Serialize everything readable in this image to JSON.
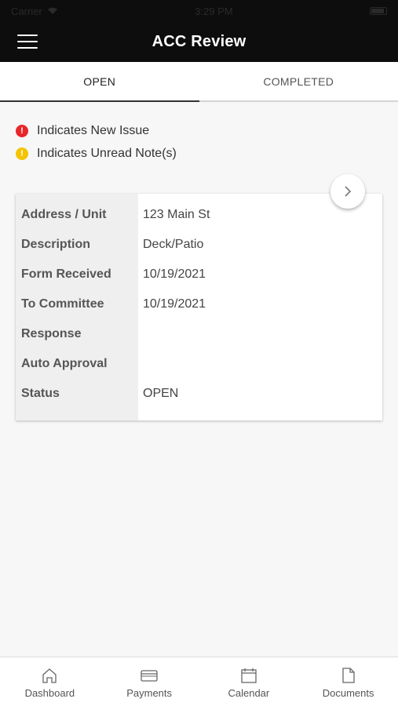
{
  "status_bar": {
    "carrier": "Carrier",
    "time": "3:29 PM"
  },
  "header": {
    "title": "ACC Review"
  },
  "tabs": [
    {
      "label": "OPEN",
      "active": true
    },
    {
      "label": "COMPLETED",
      "active": false
    }
  ],
  "legend": {
    "new_issue": {
      "glyph": "!",
      "color": "#e8262b",
      "label": "Indicates New Issue"
    },
    "unread_note": {
      "glyph": "!",
      "color": "#f5c400",
      "label": "Indicates Unread Note(s)"
    }
  },
  "card": {
    "labels": [
      "Address / Unit",
      "Description",
      "Form Received",
      "To Committee",
      "Response",
      "Auto Approval",
      "Status"
    ],
    "values": [
      "123 Main St",
      "Deck/Patio",
      "10/19/2021",
      "10/19/2021",
      "",
      "",
      "OPEN"
    ]
  },
  "bottom_nav": {
    "items": [
      {
        "label": "Dashboard",
        "icon": "home-icon"
      },
      {
        "label": "Payments",
        "icon": "credit-card-icon"
      },
      {
        "label": "Calendar",
        "icon": "calendar-icon"
      },
      {
        "label": "Documents",
        "icon": "document-icon"
      }
    ]
  }
}
